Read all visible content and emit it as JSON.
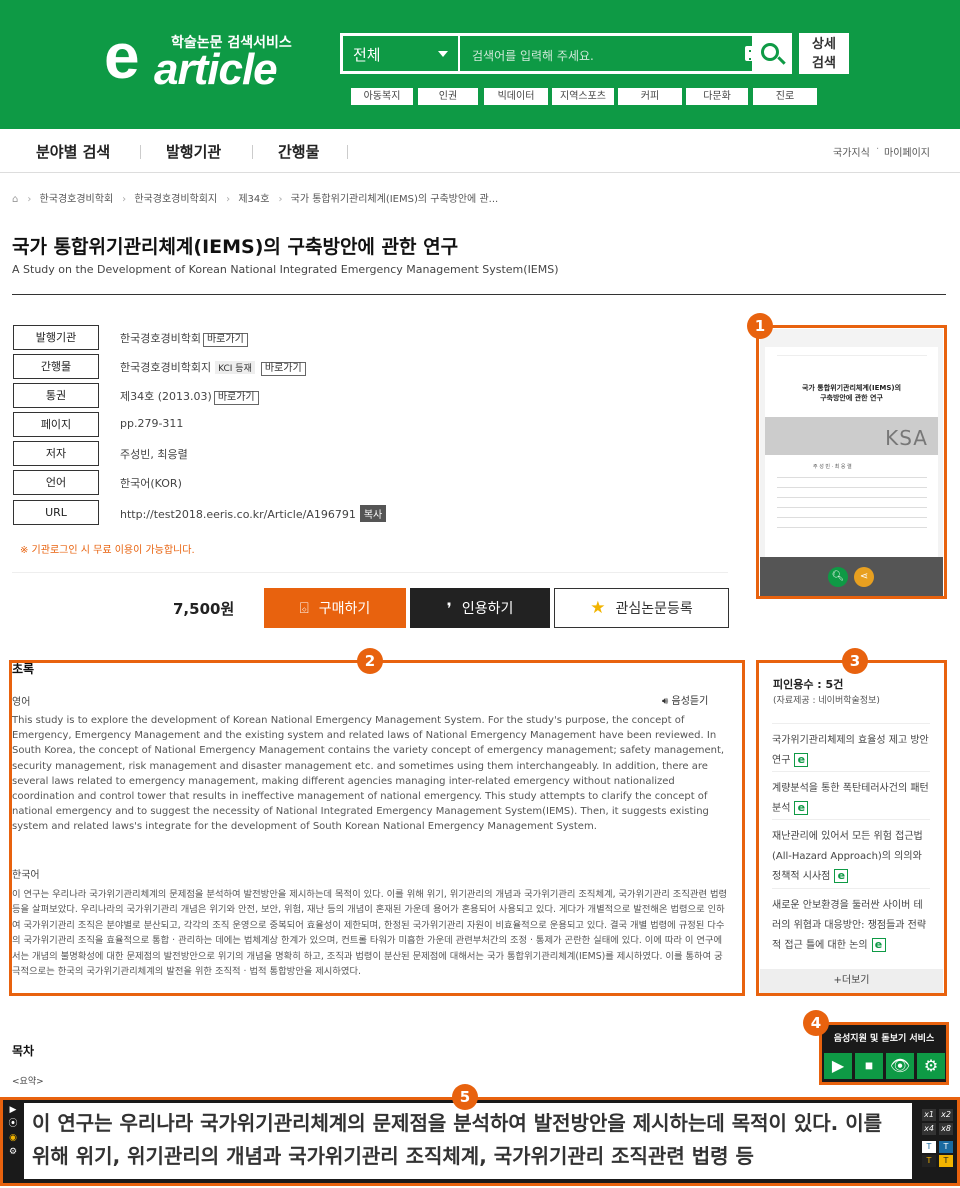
{
  "logo": {
    "tagline": "학술논문 검색서비스",
    "e": "e",
    "article": "article"
  },
  "search": {
    "scope": "전체",
    "placeholder": "검색어를 입력해 주세요.",
    "advanced_line1": "상세",
    "advanced_line2": "검색"
  },
  "keywords": [
    "아동복지",
    "인권",
    "빅데이터",
    "지역스포츠",
    "커피",
    "다문화",
    "진로"
  ],
  "nav": {
    "items": [
      "분야별 검색",
      "발행기관",
      "간행물"
    ],
    "right": [
      "국가지식",
      "마이페이지"
    ],
    "right_sep": "·"
  },
  "breadcrumb": [
    "한국경호경비학회",
    "한국경호경비학회지",
    "제34호",
    "국가 통합위기관리체계(IEMS)의 구축방안에 관..."
  ],
  "paper": {
    "title": "국가 통합위기관리체계(IEMS)의 구축방안에 관한 연구",
    "subtitle": "A Study on the Development of Korean National Integrated Emergency Management System(IEMS)"
  },
  "meta": {
    "publisher_label": "발행기관",
    "publisher": "한국경호경비학회",
    "goto": "바로가기",
    "journal_label": "간행물",
    "journal": "한국경호경비학회지",
    "kci": "KCI 등재",
    "issue_label": "통권",
    "issue": "제34호 (2013.03)",
    "pages_label": "페이지",
    "pages": "pp.279-311",
    "author_label": "저자",
    "authors": "주성빈, 최응렬",
    "language_label": "언어",
    "language": "한국어(KOR)",
    "url_label": "URL",
    "url": "http://test2018.eeris.co.kr/Article/A196791",
    "copy": "복사"
  },
  "notice": "※ 기관로그인 시 무료 이용이 가능합니다.",
  "purchase": {
    "price": "7,500원",
    "buy": "구매하기",
    "cite": "인용하기",
    "favorite": "관심논문등록"
  },
  "thumbnail": {
    "title_line1": "국가 통합위기관리체계(IEMS)의",
    "title_line2": "구축방안에 관한 연구",
    "brand": "KSA",
    "authors": "주 성 빈 · 최 응 렬"
  },
  "abstract": {
    "heading": "초록",
    "lang_en": "영어",
    "listen": "음성듣기",
    "en": "This study is to explore the development of Korean National Emergency Management System. For the study's purpose, the concept of Emergency, Emergency Management and the existing system and related laws of National Emergency Management have been reviewed. In South Korea, the concept of National Emergency Management contains the variety concept of emergency management; safety management, security management, risk management and disaster management etc. and sometimes using them interchangeably. In addition, there are several laws related to emergency management, making different agencies managing inter-related emergency without nationalized coordination and control tower that results in ineffective management of national emergency. This study attempts to clarify the concept of national emergency and to suggest the necessity of National Integrated Emergency Management System(IEMS). Then, it suggests existing system and related laws's integrate for the development of South Korean National Emergency Management System.",
    "lang_ko": "한국어",
    "ko": "이 연구는 우리나라 국가위기관리체계의 문제점을 분석하여 발전방안을 제시하는데 목적이 있다. 이를 위해 위기, 위기관리의 개념과 국가위기관리 조직체계, 국가위기관리 조직관련 법령 등을 살펴보았다. 우리나라의 국가위기관리 개념은 위기와 안전, 보안, 위험, 재난 등의 개념이 혼재된 가운데 용어가 혼용되어 사용되고 있다. 게다가 개별적으로 발전해온 법령으로 인하여 국가위기관리 조직은 분야별로 분산되고, 각각의 조직 운영으로 중복되어 효율성이 제한되며, 한정된 국가위기관리 자원이 비효율적으로 운용되고 있다. 결국 개별 법령에 규정된 다수의 국가위기관리 조직을 효율적으로 통합 · 관리하는 데에는 법체계상 한계가 있으며, 컨트롤 타워가 미흡한 가운데 관련부처간의 조정 · 통제가 곤란한 실태에 있다. 이에 따라 이 연구에서는 개념의 불명확성에 대한 문제점의 발전방안으로 위기의 개념을 명확히 하고, 조직과 법령이 분산된 문제점에 대해서는 국가 통합위기관리체계(IEMS)를 제시하였다. 이를 통하여 궁극적으로는 한국의 국가위기관리체계의 발전을 위한 조직적 · 법적 통합방안을 제시하였다."
  },
  "citations": {
    "heading": "피인용수 : 5건",
    "source": "(자료제공 : 네이버학술정보)",
    "items": [
      "국가위기관리체제의 효율성 제고 방안 연구",
      "계량분석을 통한 폭탄테러사건의 패턴분석",
      "재난관리에 있어서 모든 위험 접근법(All-Hazard Approach)의 의의와 정책적 시사점",
      "새로운 안보환경을 둘러싼 사이버 테러의 위협과 대응방안: 쟁점들과 전략적 접근 틀에 대한 논의"
    ],
    "e_icon": "e",
    "more": "+더보기"
  },
  "toc": {
    "heading": "목차",
    "first": "<요약>"
  },
  "voice_service": {
    "title": "음성지원 및 돋보기 서비스"
  },
  "reader": {
    "text": "이 연구는 우리나라 국가위기관리체계의 문제점을 분석하여 발전방안을 제시하는데 목적이 있다. 이를 위해 위기, 위기관리의 개념과 국가위기관리 조직체계, 국가위기관리 조직관련 법령 등",
    "zoom": [
      "x1",
      "x2",
      "x4",
      "x8"
    ],
    "controls": [
      "▶",
      "⦿",
      "◉",
      "⚙"
    ]
  },
  "annotations": [
    "1",
    "2",
    "3",
    "4",
    "5"
  ],
  "colors": {
    "brand_green": "#0e9a45",
    "accent_orange": "#e8620e",
    "dark": "#222222"
  }
}
